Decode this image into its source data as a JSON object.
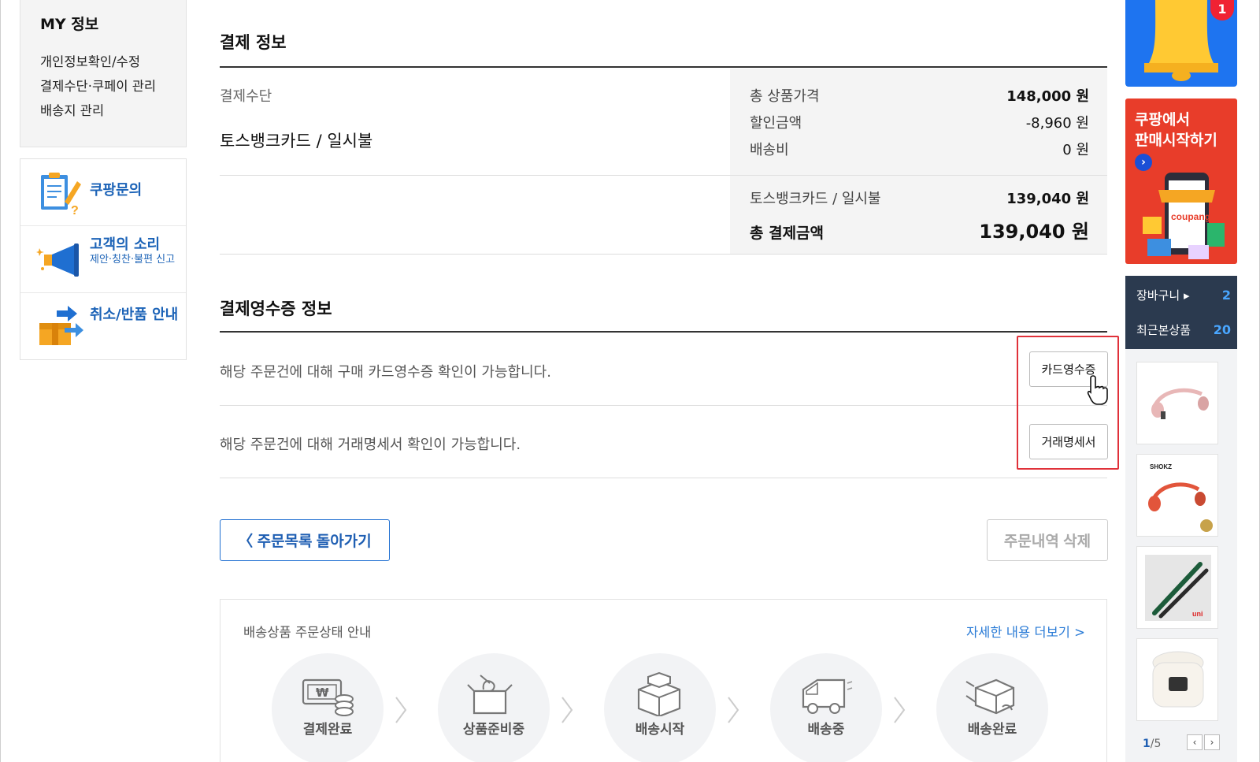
{
  "sidebar": {
    "my_title": "MY 정보",
    "links": [
      "개인정보확인/수정",
      "결제수단·쿠페이 관리",
      "배송지 관리"
    ],
    "help": [
      {
        "label": "쿠팡문의",
        "sub": ""
      },
      {
        "label": "고객의 소리",
        "sub": "제안·칭찬·불편 신고"
      },
      {
        "label": "취소/반품 안내",
        "sub": ""
      }
    ]
  },
  "payment": {
    "section_title": "결제 정보",
    "method_label": "결제수단",
    "method_value": "토스뱅크카드 / 일시불",
    "summary": {
      "items_label": "총 상품가격",
      "items_value": "148,000 원",
      "discount_label": "할인금액",
      "discount_value": "-8,960 원",
      "shipping_label": "배송비",
      "shipping_value": "0 원",
      "card_label": "토스뱅크카드 / 일시불",
      "card_value": "139,040 원",
      "total_label": "총 결제금액",
      "total_value": "139,040 원"
    }
  },
  "receipt": {
    "section_title": "결제영수증 정보",
    "rows": [
      {
        "text": "해당 주문건에 대해 구매 카드영수증 확인이 가능합니다.",
        "button": "카드영수증"
      },
      {
        "text": "해당 주문건에 대해 거래명세서 확인이 가능합니다.",
        "button": "거래명세서"
      }
    ]
  },
  "actions": {
    "back": "〈 주문목록 돌아가기",
    "delete": "주문내역 삭제"
  },
  "status": {
    "title": "배송상품 주문상태 안내",
    "more": "자세한 내용 더보기 >",
    "steps": [
      "결제완료",
      "상품준비중",
      "배송시작",
      "배송중",
      "배송완료"
    ]
  },
  "rail": {
    "bell_badge": "1",
    "seller_line1": "쿠팡에서",
    "seller_line2": "판매시작하기",
    "seller_brand": "coupang",
    "cart_label": "장바구니 ▸",
    "cart_count": "2",
    "recent_label": "최근본상품",
    "recent_count": "20",
    "thumb_brands": [
      "SHOKZ",
      "uni"
    ],
    "page_current": "1",
    "page_total": "/5"
  },
  "colors": {
    "accent_blue": "#1f5fb3",
    "link_blue": "#2a7bd6",
    "highlight_red": "#e0313a",
    "rail_dark": "#2b3a4f"
  },
  "icons": [
    "clipboard-question-icon",
    "megaphone-icon",
    "box-return-icon",
    "cursor-hand-icon",
    "bell-icon",
    "chevron-left-icon",
    "chevron-right-icon"
  ]
}
